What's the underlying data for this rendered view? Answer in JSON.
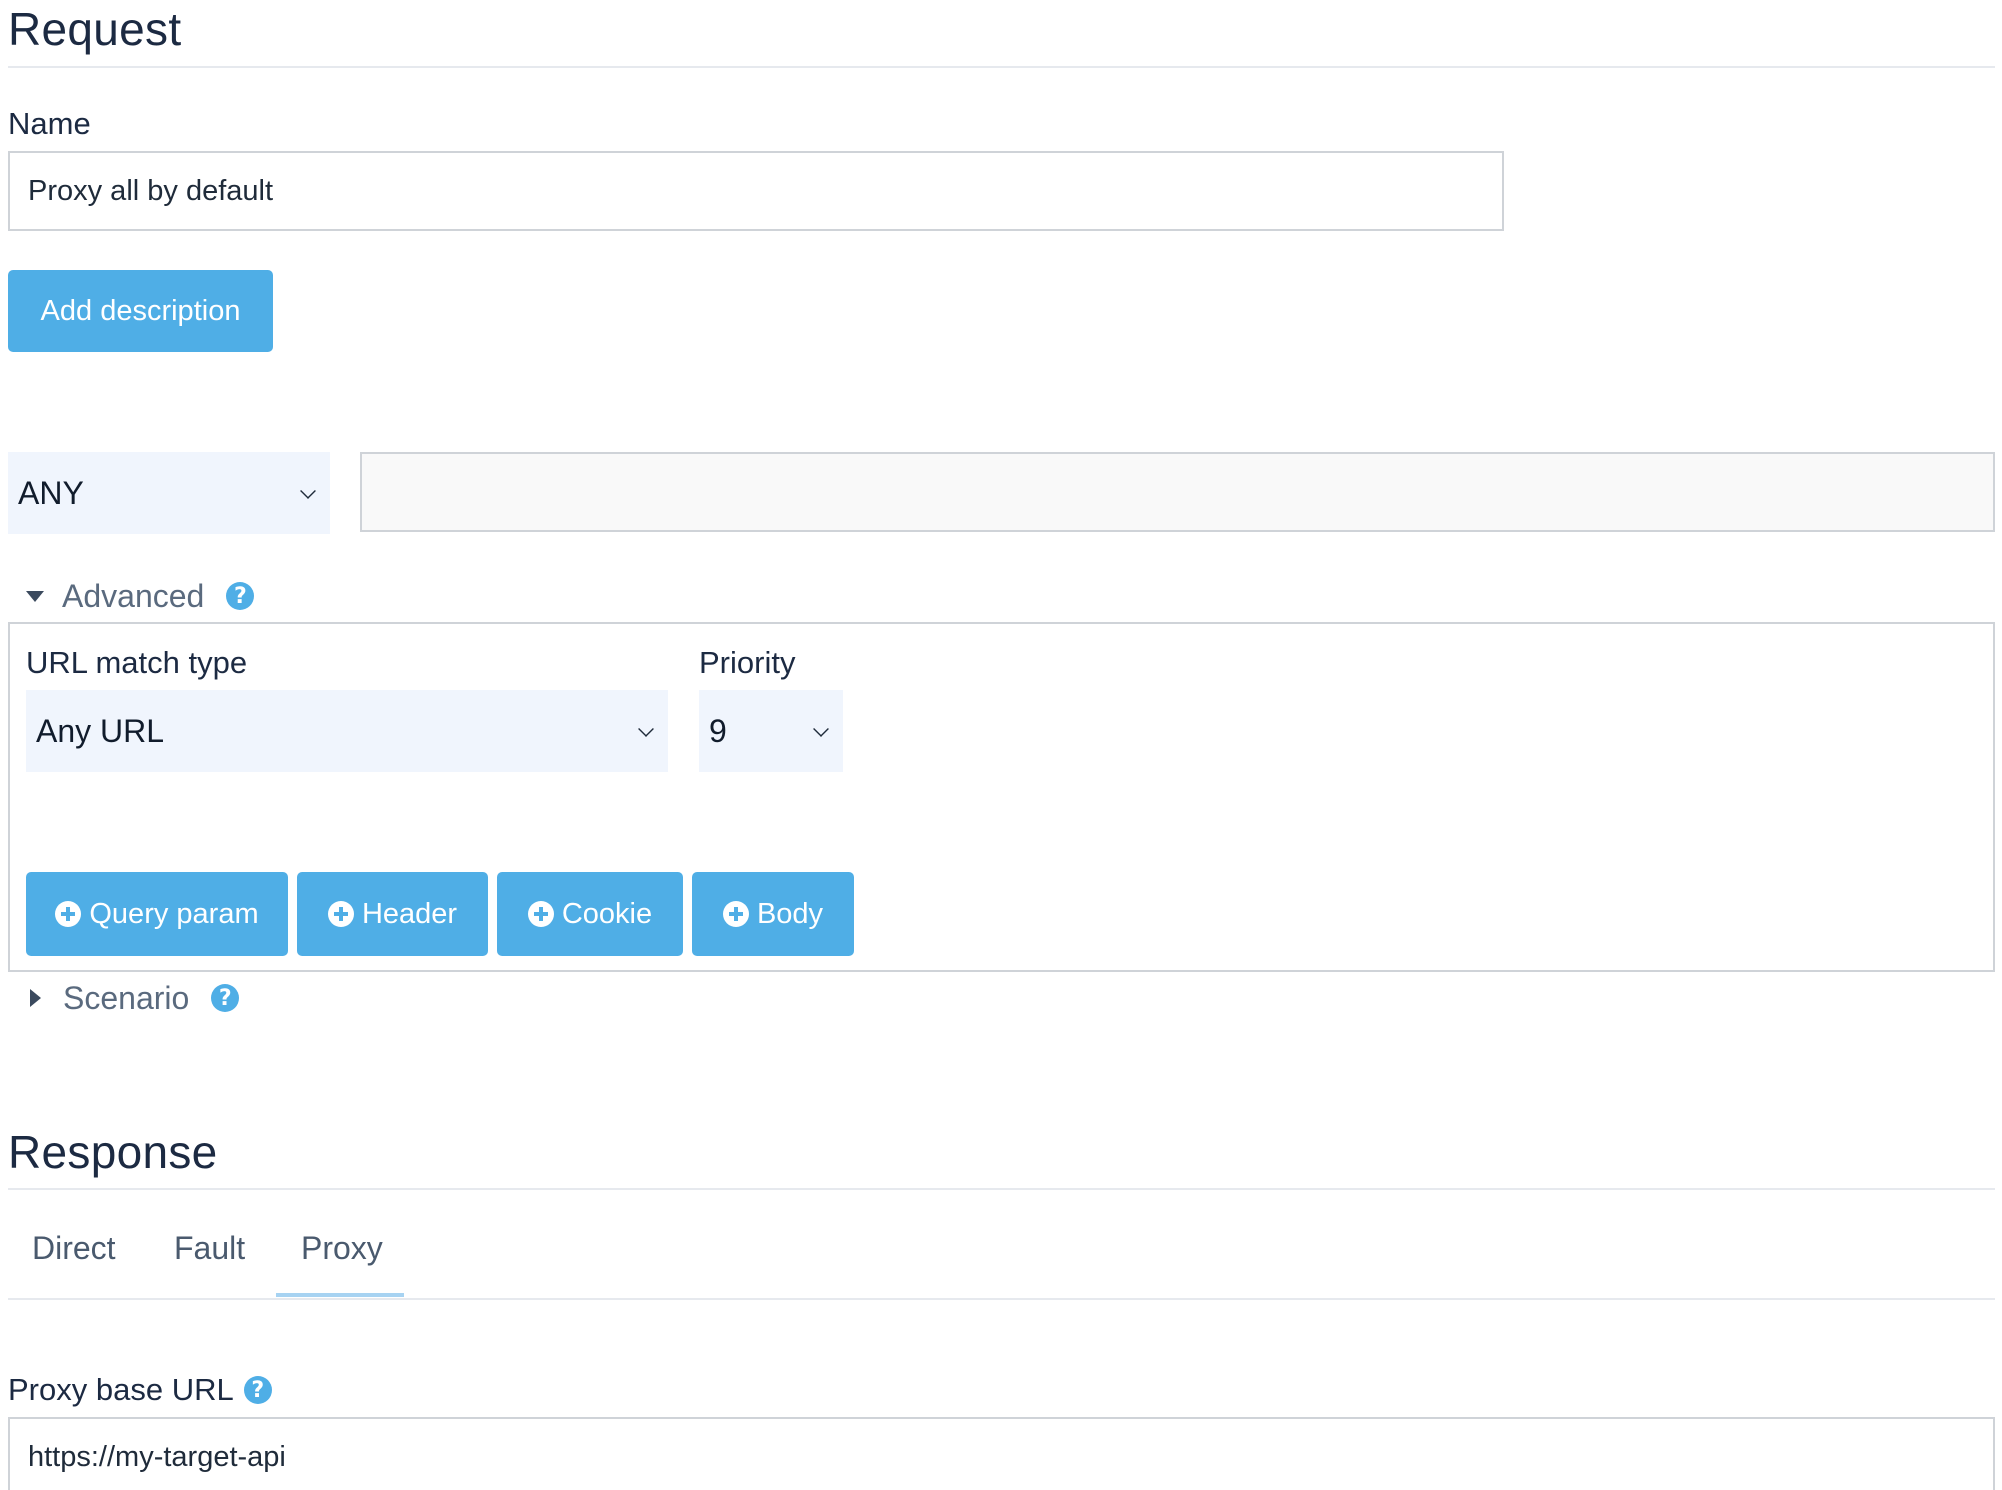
{
  "request": {
    "heading": "Request",
    "name_label": "Name",
    "name_value": "Proxy all by default",
    "add_description_label": "Add description",
    "method": {
      "selected": "ANY"
    },
    "url_value": "",
    "advanced": {
      "label": "Advanced",
      "url_match_type_label": "URL match type",
      "url_match_type_selected": "Any URL",
      "priority_label": "Priority",
      "priority_selected": "9",
      "buttons": {
        "query_param": "Query param",
        "header": "Header",
        "cookie": "Cookie",
        "body": "Body"
      }
    },
    "scenario": {
      "label": "Scenario"
    }
  },
  "response": {
    "heading": "Response",
    "tabs": [
      {
        "label": "Direct",
        "active": false
      },
      {
        "label": "Fault",
        "active": false
      },
      {
        "label": "Proxy",
        "active": true
      }
    ],
    "proxy_base_url_label": "Proxy base URL",
    "proxy_base_url_value": "https://my-target-api"
  },
  "icons": {
    "help": "?",
    "add": "plus-circle-icon",
    "expand": "triangle-icon",
    "dropdown": "chevron-down-icon"
  },
  "colors": {
    "accent": "#4faee6",
    "select_bg": "#f0f5fd",
    "heading": "#1c2a42",
    "tab_active_underline": "#a7d3f2"
  }
}
